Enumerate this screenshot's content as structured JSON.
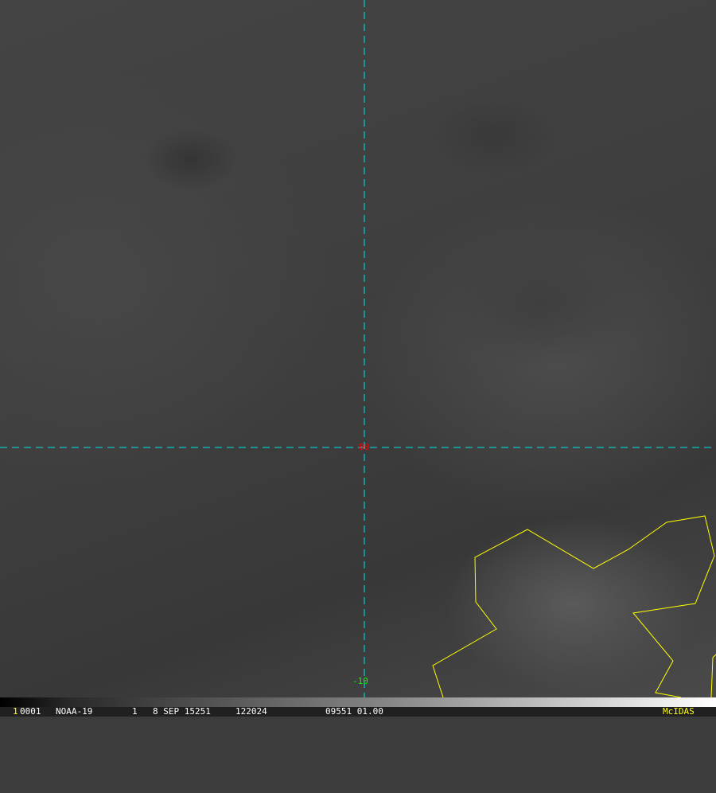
{
  "overlay": {
    "lat_label": "80",
    "lon_label": "-10",
    "grid_color": "#00e5ee",
    "lat_label_color": "#ff0000",
    "lon_label_color": "#00ff00",
    "map_color": "#ffff00"
  },
  "status_bar": {
    "frame": "1",
    "image_id": "0001",
    "satellite": "NOAA-19",
    "band": "1",
    "date": "8 SEP 15251",
    "time": "122024",
    "extra": "09551 01.00",
    "brand": "McIDAS"
  }
}
